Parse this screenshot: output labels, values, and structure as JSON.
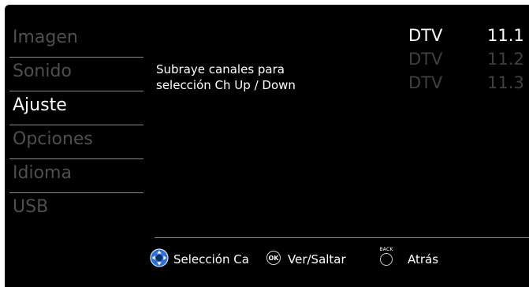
{
  "menu": {
    "items": [
      {
        "label": "Imagen"
      },
      {
        "label": "Sonido"
      },
      {
        "label": "Ajuste"
      },
      {
        "label": "Opciones"
      },
      {
        "label": "Idioma"
      },
      {
        "label": "USB"
      }
    ],
    "active_index": 2
  },
  "description": {
    "line1": "Subraye canales para",
    "line2": "selección Ch Up / Down"
  },
  "channels": [
    {
      "type": "DTV",
      "number": "11.1"
    },
    {
      "type": "DTV",
      "number": "11.2"
    },
    {
      "type": "DTV",
      "number": "11.3"
    }
  ],
  "footer": {
    "nav_label": "Selección Ca",
    "ok_icon_text": "OK",
    "ok_label": "Ver/Saltar",
    "back_icon_text": "BACK",
    "back_label": "Atrás"
  },
  "icons": {
    "nav": "dpad-icon",
    "ok": "ok-button-icon",
    "back": "back-button-icon"
  },
  "colors": {
    "background": "#000000",
    "active_text": "#ffffff",
    "inactive_text": "#4f4f4f",
    "divider": "#8a8a8a"
  }
}
